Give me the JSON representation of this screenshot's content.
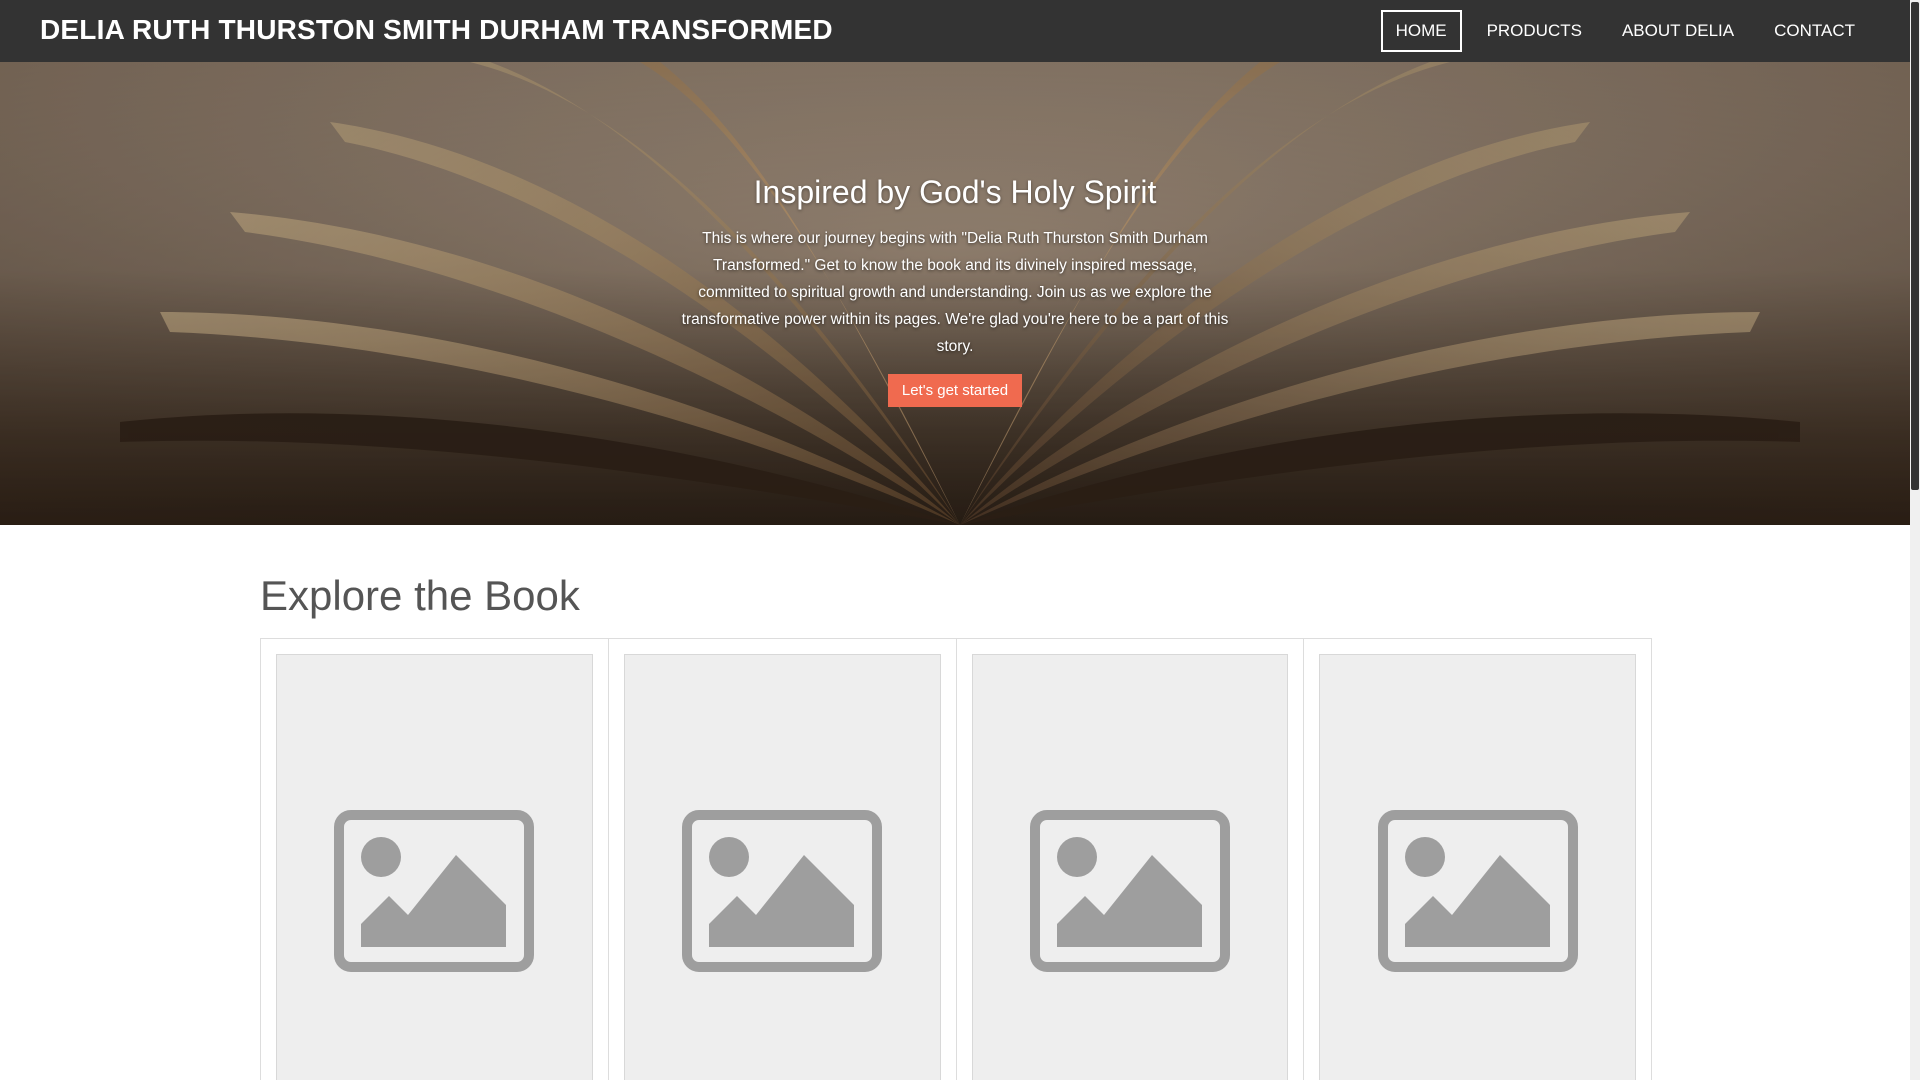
{
  "header": {
    "site_title": "DELIA RUTH THURSTON SMITH DURHAM TRANSFORMED",
    "nav": [
      {
        "label": "HOME",
        "active": true
      },
      {
        "label": "PRODUCTS",
        "active": false
      },
      {
        "label": "ABOUT DELIA",
        "active": false
      },
      {
        "label": "CONTACT",
        "active": false
      }
    ]
  },
  "hero": {
    "heading": "Inspired by God's Holy Spirit",
    "text": "This is where our journey begins with \"Delia Ruth Thurston Smith Durham Transformed.\" Get to know the book and its divinely inspired message, committed to spiritual growth and understanding. Join us as we explore the transformative power within its pages. We're glad you're here to be a part of this story.",
    "button_label": "Let's get started",
    "button_color": "#f06a4f"
  },
  "explore": {
    "title": "Explore the Book",
    "cards": [
      {
        "icon": "image-placeholder-icon"
      },
      {
        "icon": "image-placeholder-icon"
      },
      {
        "icon": "image-placeholder-icon"
      },
      {
        "icon": "image-placeholder-icon"
      }
    ]
  },
  "colors": {
    "header_bg": "#333333",
    "accent": "#f06a4f",
    "placeholder_bg": "#eeeeee",
    "placeholder_icon": "#9e9e9e"
  }
}
